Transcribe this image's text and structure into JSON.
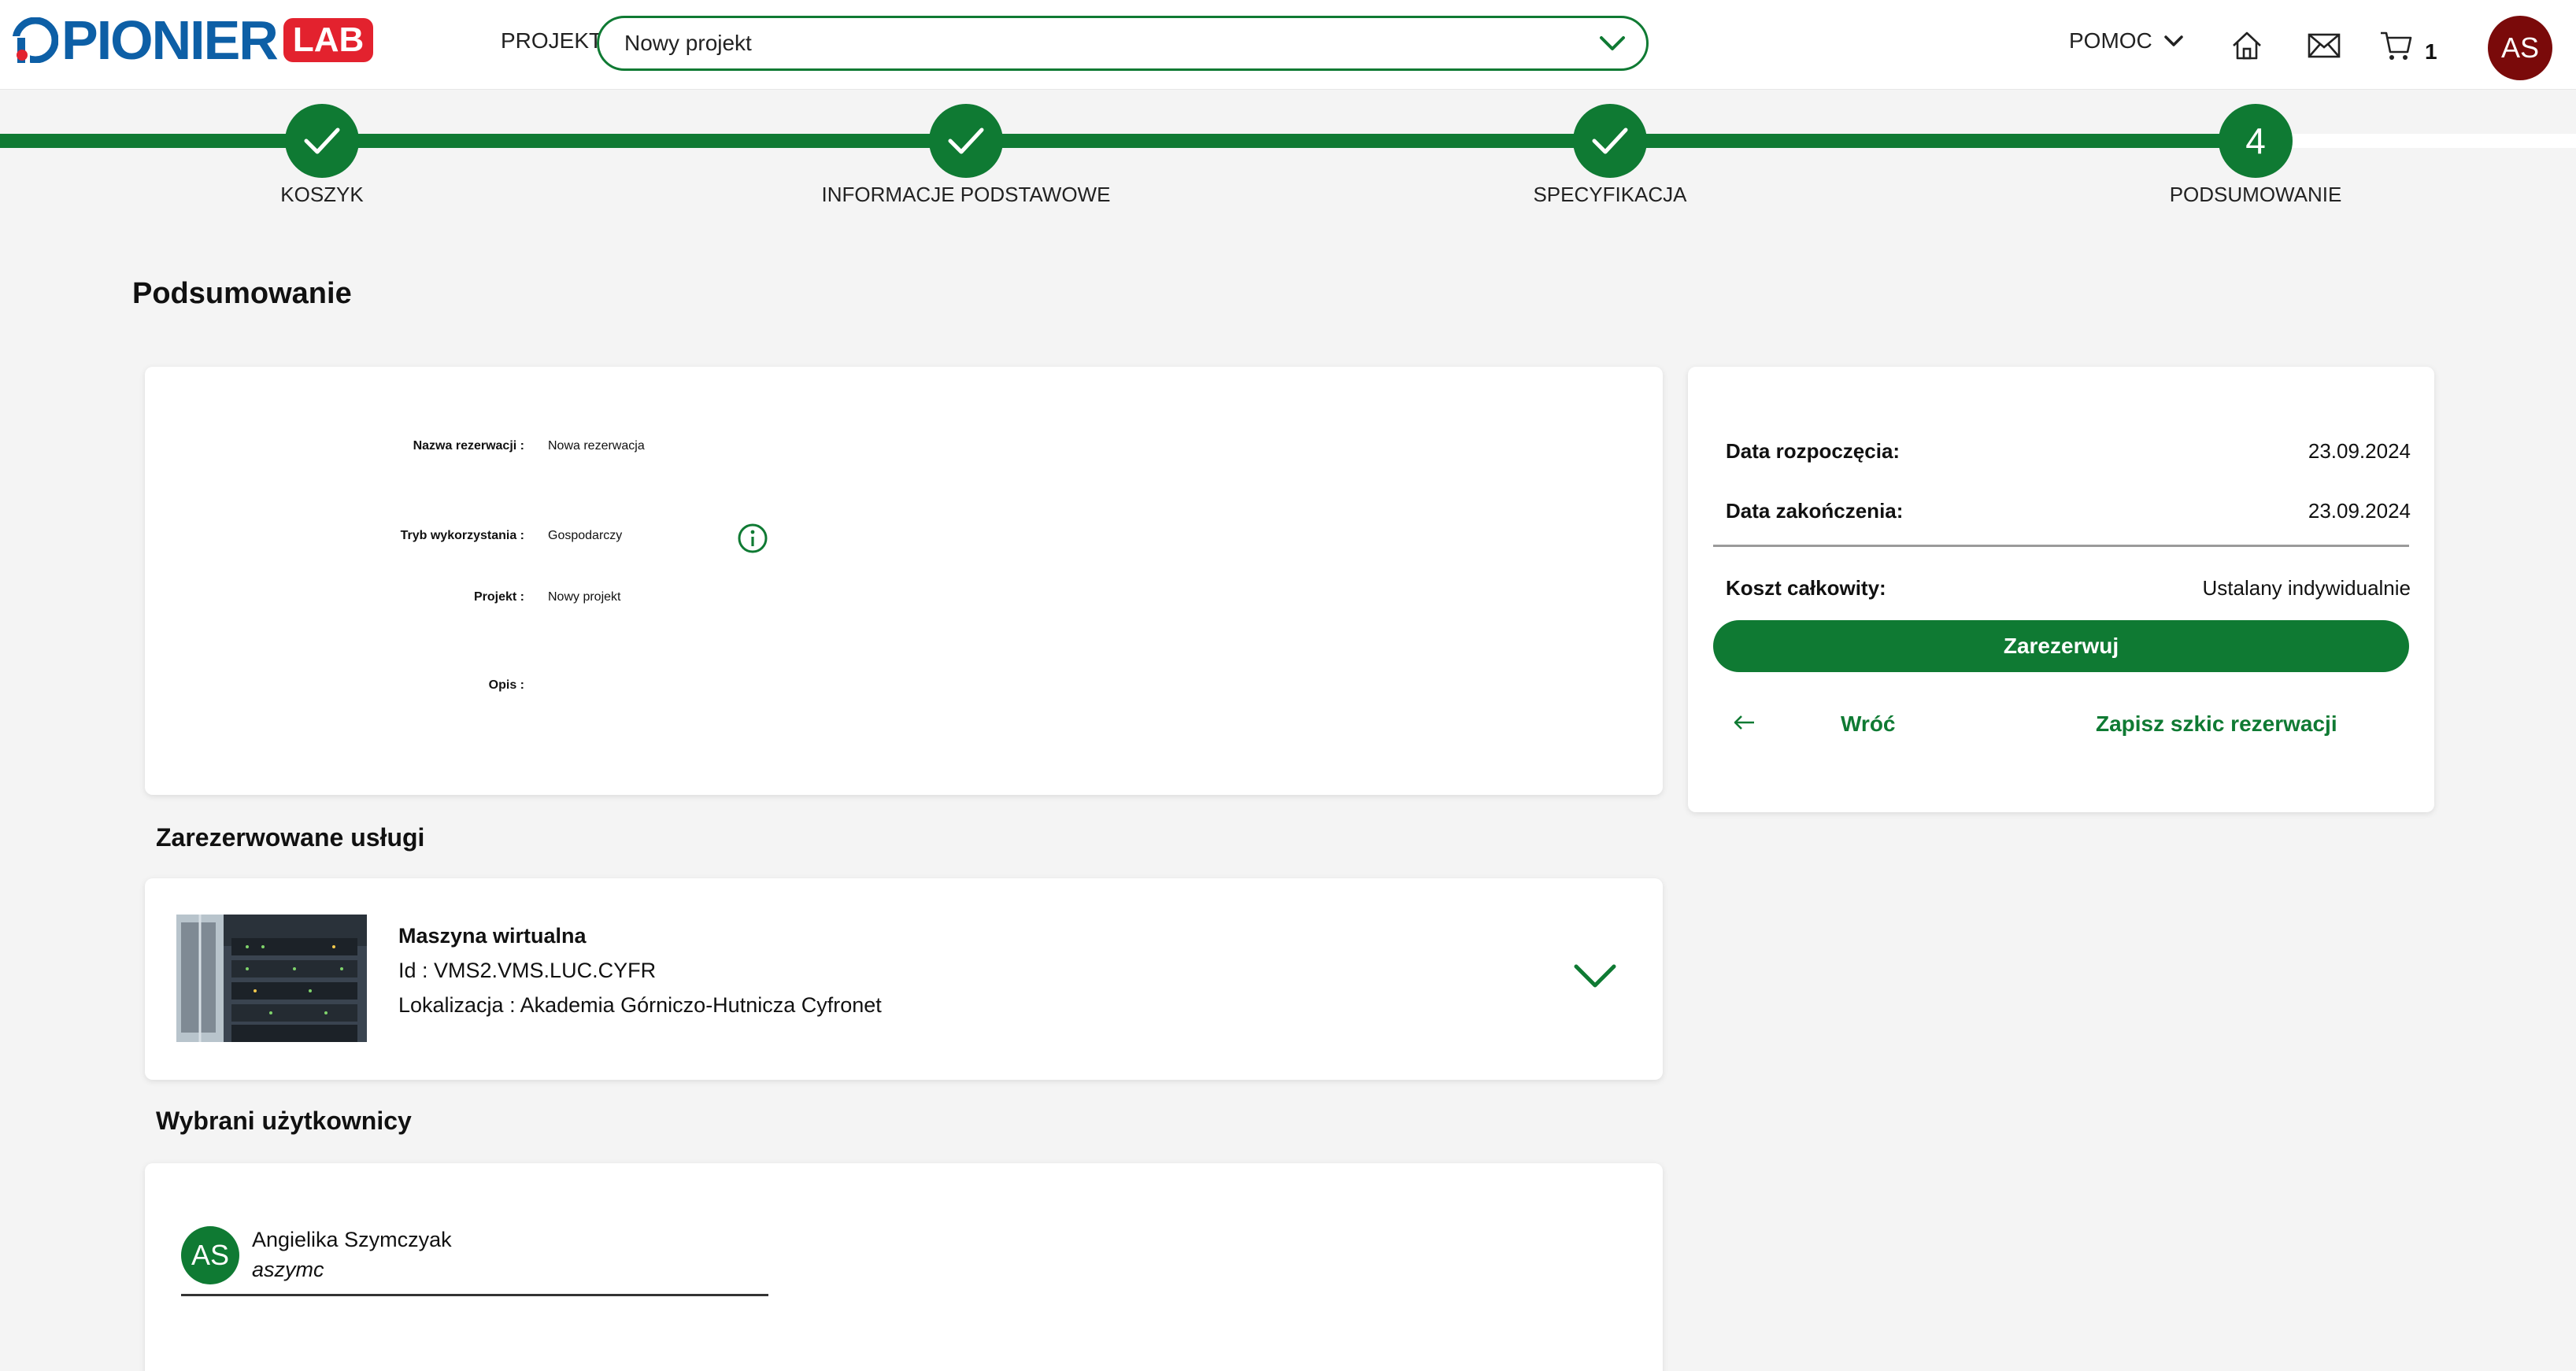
{
  "header": {
    "logo_text": "PIONIER",
    "logo_lab": "LAB",
    "project_label": "PROJEKT",
    "project_value": "Nowy projekt",
    "help_label": "POMOC",
    "cart_count": "1",
    "avatar_initials": "AS"
  },
  "stepper": {
    "steps": [
      {
        "label": "KOSZYK",
        "state": "done"
      },
      {
        "label": "INFORMACJE PODSTAWOWE",
        "state": "done"
      },
      {
        "label": "SPECYFIKACJA",
        "state": "done"
      },
      {
        "label": "PODSUMOWANIE",
        "state": "current",
        "number": "4"
      }
    ]
  },
  "page_title": "Podsumowanie",
  "details": {
    "name_label": "Nazwa rezerwacji :",
    "name_value": "Nowa rezerwacja",
    "mode_label": "Tryb wykorzystania :",
    "mode_value": "Gospodarczy",
    "project_label": "Projekt :",
    "project_value": "Nowy projekt",
    "description_label": "Opis :",
    "description_value": ""
  },
  "summary": {
    "start_label": "Data rozpoczęcia:",
    "start_value": "23.09.2024",
    "end_label": "Data zakończenia:",
    "end_value": "23.09.2024",
    "cost_label": "Koszt całkowity:",
    "cost_value": "Ustalany indywidualnie",
    "reserve_button": "Zarezerwuj",
    "back_link": "Wróć",
    "save_draft_link": "Zapisz szkic rezerwacji"
  },
  "services": {
    "title": "Zarezerwowane usługi",
    "items": [
      {
        "name": "Maszyna wirtualna",
        "id_line": "Id : VMS2.VMS.LUC.CYFR",
        "location_line": "Lokalizacja : Akademia Górniczo-Hutnicza Cyfronet"
      }
    ]
  },
  "users": {
    "title": "Wybrani użytkownicy",
    "items": [
      {
        "initials": "AS",
        "name": "Angielika Szymczyak",
        "login": "aszymc"
      }
    ]
  },
  "colors": {
    "accent": "#0f7a33",
    "brand_blue": "#0d5fa6",
    "brand_red": "#e3222e",
    "avatar_header": "#7a0a0a"
  }
}
